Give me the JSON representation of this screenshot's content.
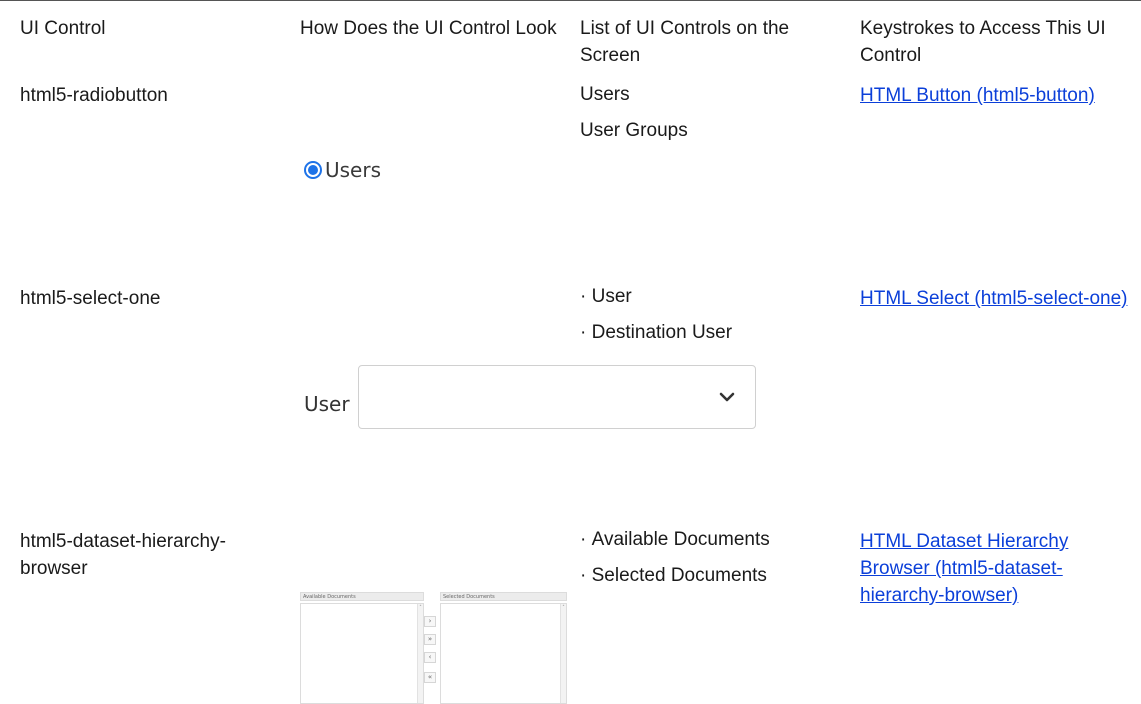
{
  "headers": [
    "UI Control",
    "How Does the UI Control Look",
    "List of UI Controls on the Screen",
    "Keystrokes to Access This UI Control"
  ],
  "rows": [
    {
      "control": "html5-radiobutton",
      "sample": {
        "radio_label": "Users"
      },
      "list": [
        "Users",
        "User Groups"
      ],
      "link": "HTML Button (html5-button)"
    },
    {
      "control": "html5-select-one",
      "sample": {
        "select_label": "User",
        "select_value": ""
      },
      "list": [
        "User",
        "Destination User"
      ],
      "link": "HTML Select (html5-select-one)"
    },
    {
      "control": "html5-dataset-hierarchy-browser",
      "sample": {
        "available_header": "Available Documents",
        "selected_header": "Selected Documents",
        "buttons": [
          "›",
          "»",
          "‹",
          "«"
        ]
      },
      "list": [
        "Available Documents",
        "Selected Documents"
      ],
      "link": "HTML Dataset Hierarchy Browser (html5-dataset-hierarchy-browser)"
    }
  ],
  "colors": {
    "link": "#0b3fd9",
    "radio_accent": "#1e73e8"
  },
  "icons": {
    "radio": "radio-selected-icon",
    "select": "chevron-down-icon"
  }
}
